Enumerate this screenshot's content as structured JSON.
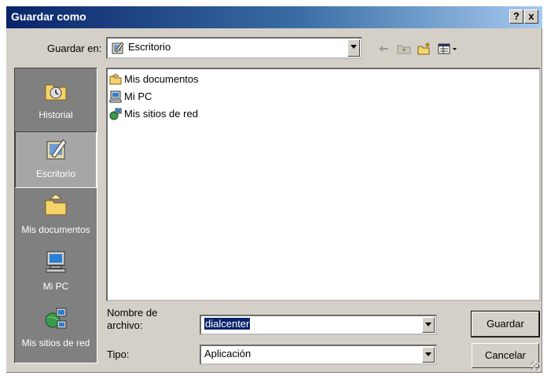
{
  "window": {
    "title": "Guardar como",
    "help_label": "?",
    "close_label": "x"
  },
  "lookin": {
    "label": "Guardar en:",
    "value": "Escritorio"
  },
  "toolbar": {
    "icons": [
      "back-arrow-icon",
      "up-folder-icon",
      "new-folder-icon",
      "view-menu-icon"
    ]
  },
  "places": [
    {
      "label": "Historial",
      "icon": "history-icon"
    },
    {
      "label": "Escritorio",
      "icon": "desktop-icon",
      "selected": true
    },
    {
      "label": "Mis documentos",
      "icon": "my-documents-icon"
    },
    {
      "label": "Mi PC",
      "icon": "my-computer-icon"
    },
    {
      "label": "Mis sitios de red",
      "icon": "network-places-icon"
    }
  ],
  "files": [
    {
      "name": "Mis documentos",
      "icon": "folder-icon"
    },
    {
      "name": "Mi PC",
      "icon": "computer-icon"
    },
    {
      "name": "Mis sitios de red",
      "icon": "network-icon"
    }
  ],
  "filename": {
    "label_line1": "Nombre de",
    "label_line2": "archivo:",
    "value": "dialcenter"
  },
  "filetype": {
    "label": "Tipo:",
    "value": "Aplicación"
  },
  "buttons": {
    "save": "Guardar",
    "cancel": "Cancelar"
  },
  "colors": {
    "title_start": "#0a246a",
    "title_end": "#a6caf0",
    "face": "#d4d0c8",
    "places_bar": "#808080",
    "selection": "#0a246a"
  }
}
